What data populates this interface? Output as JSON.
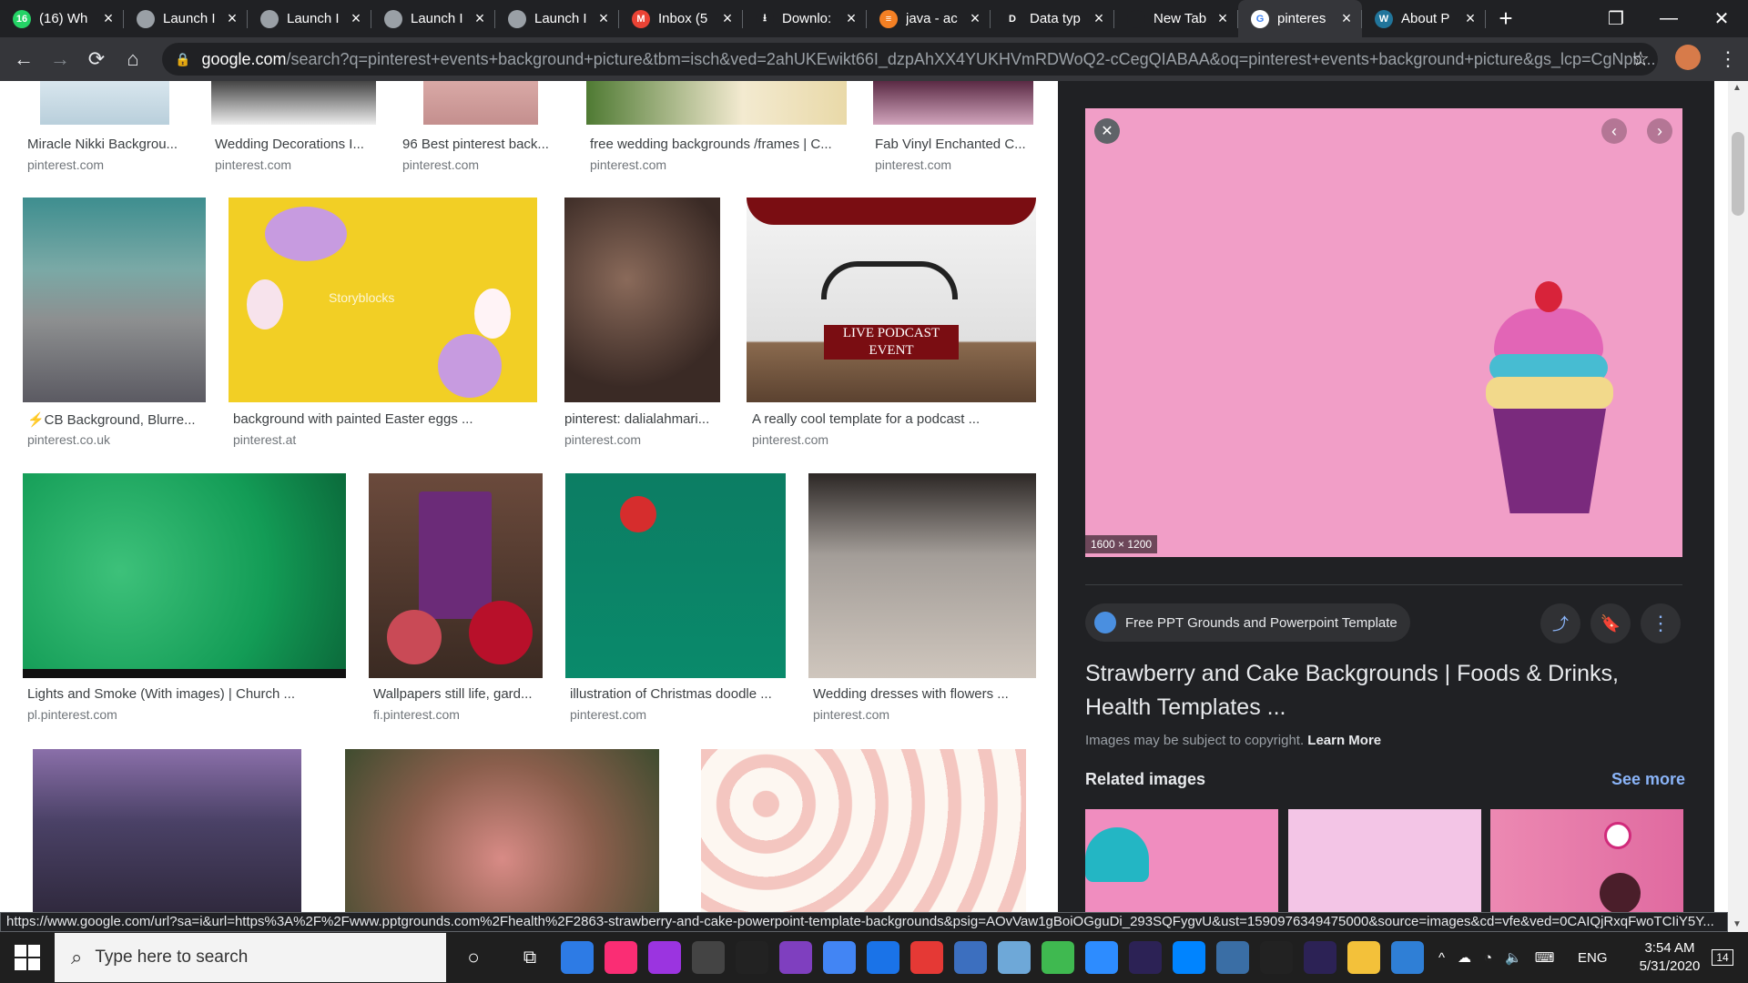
{
  "tabs": [
    {
      "title": "(16) Wh",
      "icon": "whatsapp-icon",
      "color": "#25d366",
      "glyph": "16"
    },
    {
      "title": "Launch I",
      "icon": "globe-icon",
      "color": "#9aa0a6",
      "glyph": ""
    },
    {
      "title": "Launch I",
      "icon": "globe-icon",
      "color": "#9aa0a6",
      "glyph": ""
    },
    {
      "title": "Launch I",
      "icon": "globe-icon",
      "color": "#9aa0a6",
      "glyph": ""
    },
    {
      "title": "Launch I",
      "icon": "globe-icon",
      "color": "#9aa0a6",
      "glyph": ""
    },
    {
      "title": "Inbox (5",
      "icon": "gmail-icon",
      "color": "#ea4335",
      "glyph": "M"
    },
    {
      "title": "Downlo:",
      "icon": "download-icon",
      "color": "#202124",
      "glyph": "⭳"
    },
    {
      "title": "java - ac",
      "icon": "stackoverflow-icon",
      "color": "#f48024",
      "glyph": "≡"
    },
    {
      "title": "Data typ",
      "icon": "d-icon",
      "color": "#202124",
      "glyph": "D"
    },
    {
      "title": "New Tab",
      "icon": "none",
      "color": "#202124",
      "glyph": ""
    },
    {
      "title": "pinteres",
      "icon": "google-icon",
      "color": "#ffffff",
      "glyph": "G",
      "active": true
    },
    {
      "title": "About P",
      "icon": "wordpress-icon",
      "color": "#21759b",
      "glyph": "W"
    }
  ],
  "toolbar": {
    "url_domain": "google.com",
    "url_rest": "/search?q=pinterest+events+background+picture&tbm=isch&ved=2ahUKEwikt66I_dzpAhXX4YUKHVmRDWoQ2-cCegQIABAA&oq=pinterest+events+background+picture&gs_lcp=CgNpb..."
  },
  "results_top_row": [
    {
      "caption": "Miracle Nikki Backgrou...",
      "source": "pinterest.com"
    },
    {
      "caption": "Wedding Decorations I...",
      "source": "pinterest.com"
    },
    {
      "caption": "96 Best pinterest back...",
      "source": "pinterest.com"
    },
    {
      "caption": "free wedding backgrounds /frames | C...",
      "source": "pinterest.com"
    },
    {
      "caption": "Fab Vinyl Enchanted C...",
      "source": "pinterest.com"
    }
  ],
  "results_row2": [
    {
      "caption": "⚡CB Background, Blurre...",
      "source": "pinterest.co.uk"
    },
    {
      "caption": "background with painted Easter eggs ...",
      "source": "pinterest.at",
      "watermark": "Storyblocks"
    },
    {
      "caption": "pinterest: dalialahmari...",
      "source": "pinterest.com"
    },
    {
      "caption": "A really cool template for a podcast ...",
      "source": "pinterest.com",
      "overlay": {
        "line1": "LIVE PODCAST",
        "line2": "EVENT"
      }
    }
  ],
  "results_row3": [
    {
      "caption": "Lights and Smoke (With images) | Church ...",
      "source": "pl.pinterest.com"
    },
    {
      "caption": "Wallpapers still life, gard...",
      "source": "fi.pinterest.com"
    },
    {
      "caption": "illustration of Christmas doodle ...",
      "source": "pinterest.com"
    },
    {
      "caption": "Wedding dresses with flowers ...",
      "source": "pinterest.com"
    }
  ],
  "panel": {
    "dimensions": "1600 × 1200",
    "source_name": "Free PPT Grounds and Powerpoint Template",
    "title": "Strawberry and Cake Backgrounds | Foods & Drinks, Health Templates ...",
    "copyright": "Images may be subject to copyright.",
    "learn_more": "Learn More",
    "related_label": "Related images",
    "see_more": "See more",
    "preview_bg": "#f19ec7"
  },
  "status_url": "https://www.google.com/url?sa=i&url=https%3A%2F%2Fwww.pptgrounds.com%2Fhealth%2F2863-strawberry-and-cake-powerpoint-template-backgrounds&psig=AOvVaw1gBoiOGguDi_293SQFygvU&ust=1590976349475000&source=images&cd=vfe&ved=0CAIQjRxqFwoTCIiY5Y...",
  "taskbar": {
    "search_placeholder": "Type here to search",
    "lang": "ENG",
    "time": "3:54 AM",
    "date": "5/31/2020",
    "notifications": "14"
  }
}
